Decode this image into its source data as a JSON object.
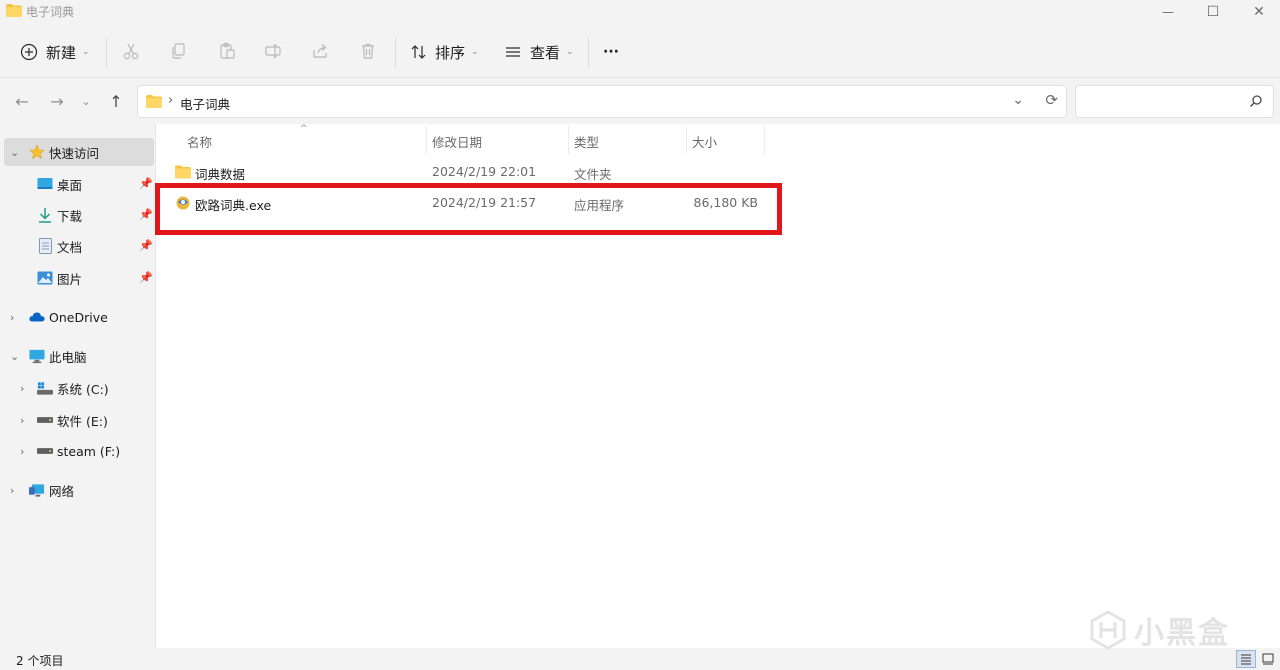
{
  "window": {
    "title": "电子词典",
    "controls": {
      "minimize": "—",
      "maximize": "☐",
      "close": "✕"
    }
  },
  "toolbar": {
    "new_label": "新建",
    "sort_label": "排序",
    "view_label": "查看",
    "more_label": "···"
  },
  "address": {
    "crumb": "电子词典",
    "separator": "›",
    "search_placeholder": ""
  },
  "sidebar": {
    "quick_access": "快速访问",
    "quick_items": [
      {
        "label": "桌面",
        "icon": "desktop-icon"
      },
      {
        "label": "下载",
        "icon": "download-icon"
      },
      {
        "label": "文档",
        "icon": "document-icon"
      },
      {
        "label": "图片",
        "icon": "pictures-icon"
      }
    ],
    "onedrive": "OneDrive",
    "this_pc": "此电脑",
    "drives": [
      {
        "label": "系统 (C:)",
        "icon": "system-drive-icon"
      },
      {
        "label": "软件 (E:)",
        "icon": "drive-icon"
      },
      {
        "label": "steam (F:)",
        "icon": "drive-icon"
      }
    ],
    "network": "网络"
  },
  "columns": {
    "name": "名称",
    "modified": "修改日期",
    "type": "类型",
    "size": "大小"
  },
  "files": [
    {
      "name": "词典数据",
      "modified": "2024/2/19 22:01",
      "type": "文件夹",
      "size": "",
      "icon": "folder-icon"
    },
    {
      "name": "欧路词典.exe",
      "modified": "2024/2/19 21:57",
      "type": "应用程序",
      "size": "86,180 KB",
      "icon": "app-icon"
    }
  ],
  "status": {
    "item_count": "2 个项目"
  },
  "watermark": {
    "text": "小黑盒"
  },
  "colors": {
    "highlight_border": "#e0161b",
    "folder_yellow": "#f4c542",
    "accent_blue": "#0a64c8"
  }
}
